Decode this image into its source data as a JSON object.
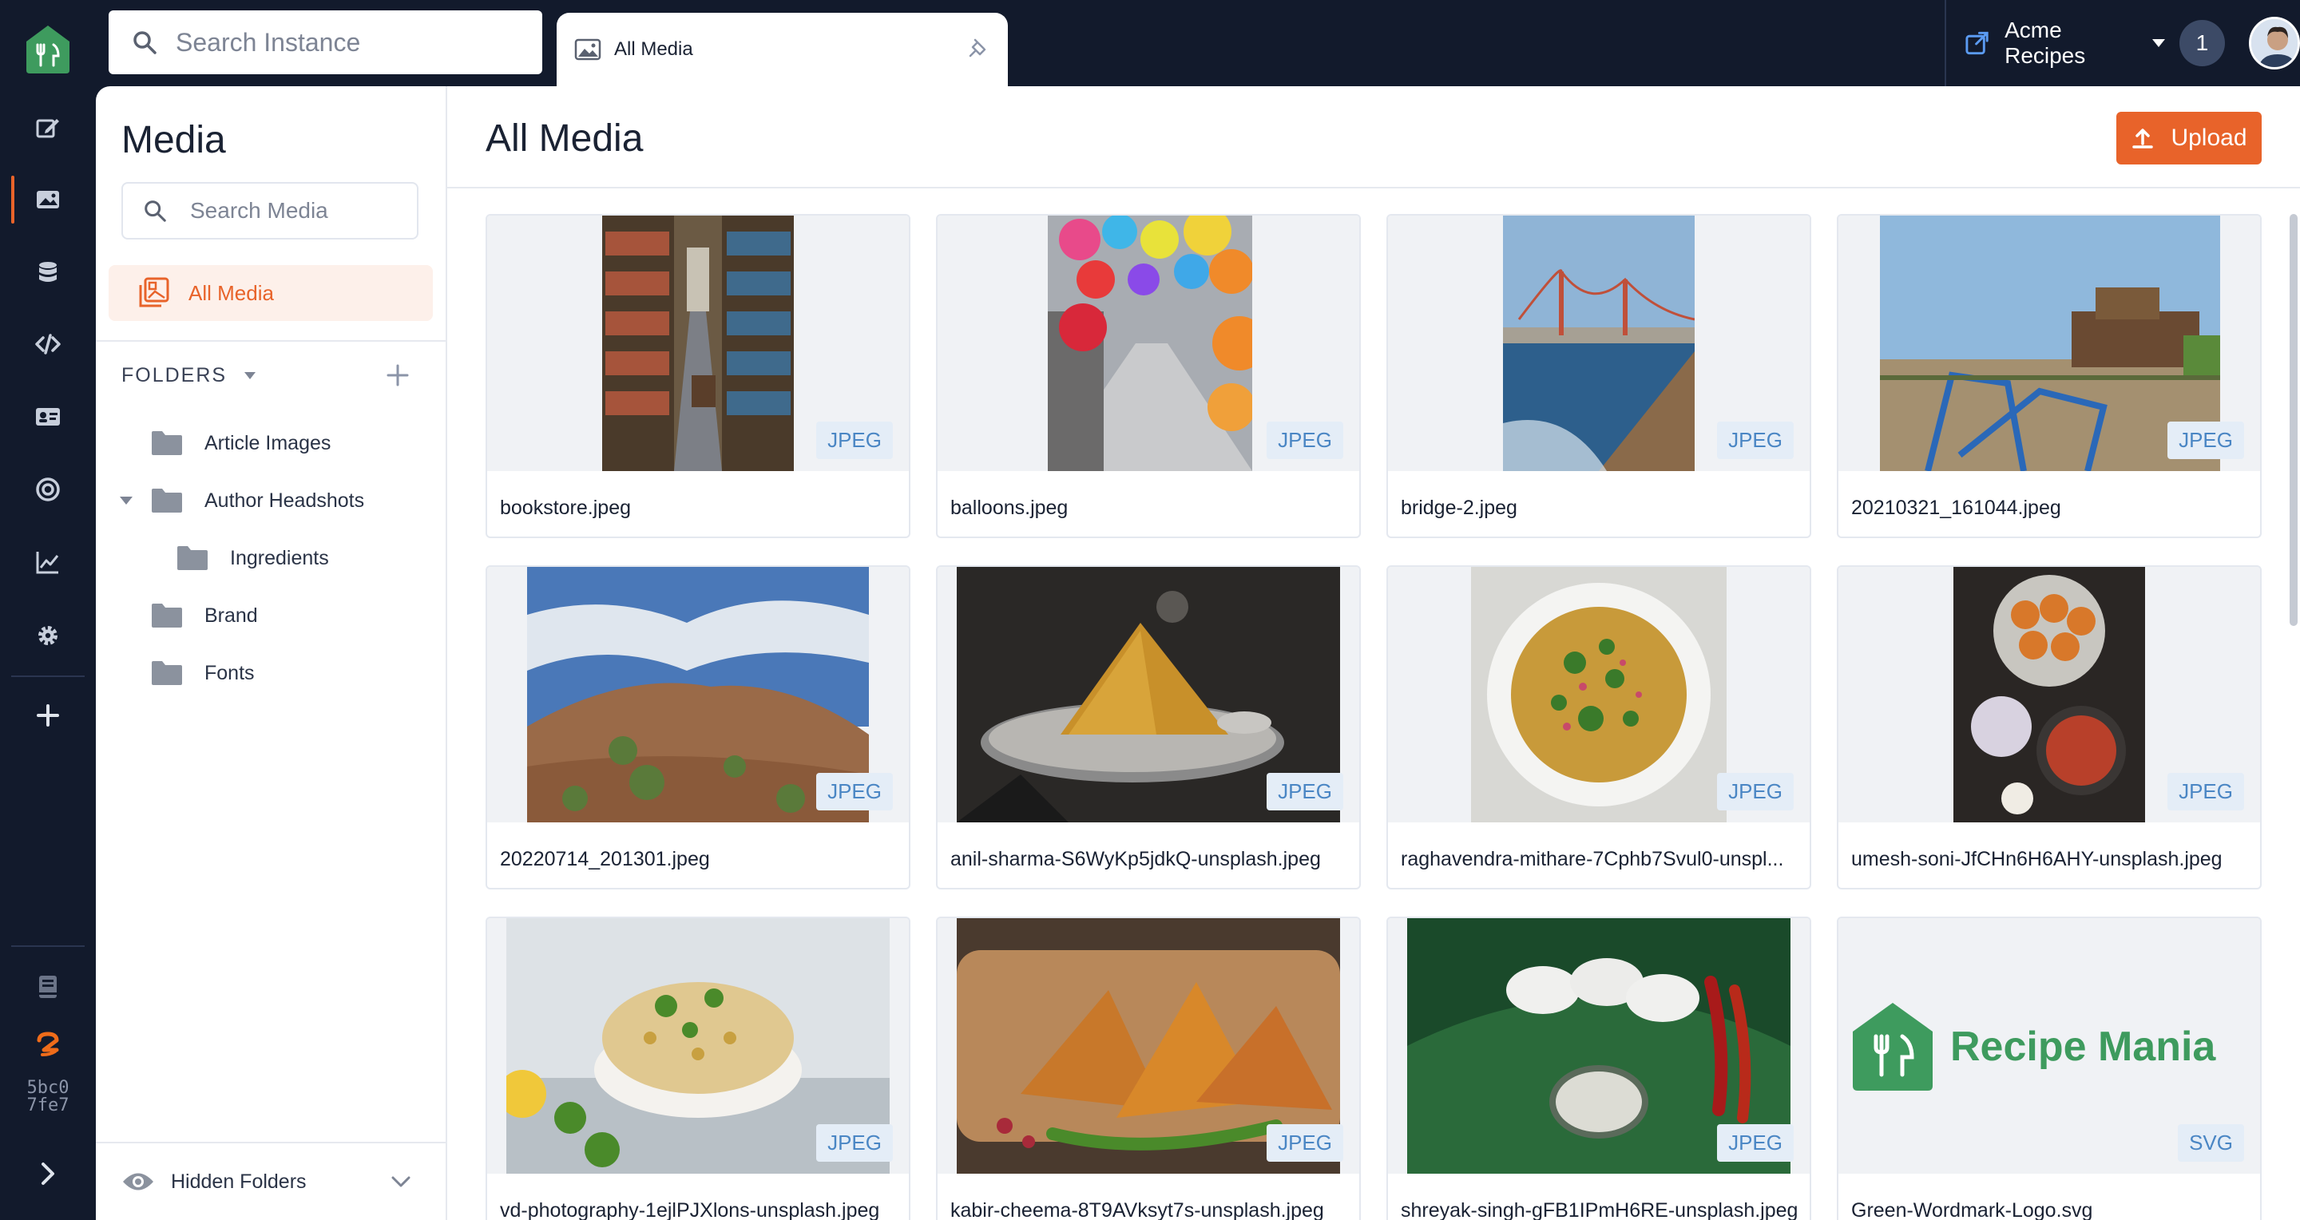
{
  "app": {
    "search_placeholder": "Search Instance",
    "tab_label": "All Media",
    "instance_name": "Acme Recipes",
    "notification_count": "1",
    "build_hash_line1": "5bc0",
    "build_hash_line2": "7fe7",
    "accent_color": "#e8632a",
    "brand_color": "#3e9b5e"
  },
  "sidebar": {
    "title": "Media",
    "search_placeholder": "Search Media",
    "all_media_label": "All Media",
    "folders_heading": "FOLDERS",
    "folders": [
      {
        "label": "Article Images"
      },
      {
        "label": "Author Headshots"
      },
      {
        "label": "Ingredients"
      },
      {
        "label": "Brand"
      },
      {
        "label": "Fonts"
      }
    ],
    "hidden_folders_label": "Hidden Folders"
  },
  "main": {
    "title": "All Media",
    "upload_label": "Upload",
    "files": [
      {
        "name": "bookstore.jpeg",
        "type": "JPEG"
      },
      {
        "name": "balloons.jpeg",
        "type": "JPEG"
      },
      {
        "name": "bridge-2.jpeg",
        "type": "JPEG"
      },
      {
        "name": "20210321_161044.jpeg",
        "type": "JPEG"
      },
      {
        "name": "20220714_201301.jpeg",
        "type": "JPEG"
      },
      {
        "name": "anil-sharma-S6WyKp5jdkQ-unsplash.jpeg",
        "type": "JPEG"
      },
      {
        "name": "raghavendra-mithare-7Cphb7Svul0-unspl...",
        "type": "JPEG"
      },
      {
        "name": "umesh-soni-JfCHn6H6AHY-unsplash.jpeg",
        "type": "JPEG"
      },
      {
        "name": "vd-photography-1ejlPJXlons-unsplash.jpeg",
        "type": "JPEG"
      },
      {
        "name": "kabir-cheema-8T9AVksyt7s-unsplash.jpeg",
        "type": "JPEG"
      },
      {
        "name": "shreyak-singh-gFB1IPmH6RE-unsplash.jpeg",
        "type": "JPEG"
      },
      {
        "name": "Green-Wordmark-Logo.svg",
        "type": "SVG",
        "wordmark": "Recipe Mania"
      }
    ]
  }
}
